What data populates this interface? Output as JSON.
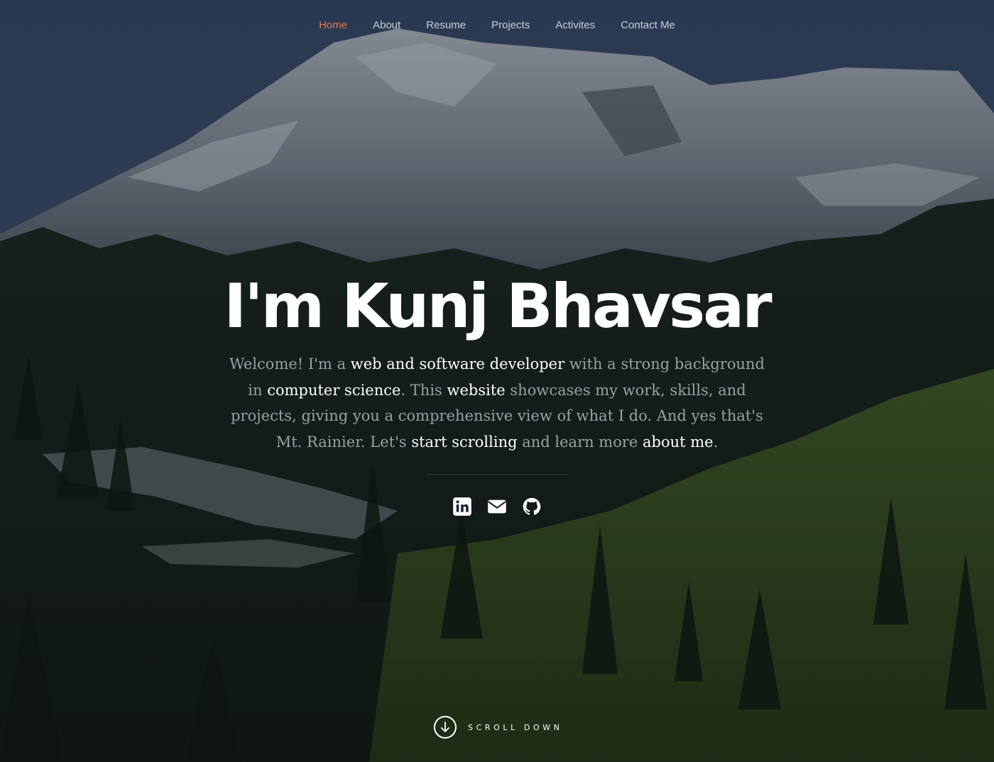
{
  "nav": {
    "items": [
      {
        "label": "Home",
        "active": true
      },
      {
        "label": "About",
        "active": false
      },
      {
        "label": "Resume",
        "active": false
      },
      {
        "label": "Projects",
        "active": false
      },
      {
        "label": "Activites",
        "active": false
      },
      {
        "label": "Contact Me",
        "active": false
      }
    ],
    "active_color": "#e5793f"
  },
  "hero": {
    "title": "I'm Kunj Bhavsar",
    "intro": [
      {
        "text": "Welcome! I'm a ",
        "highlight": false
      },
      {
        "text": "web and software developer",
        "highlight": true
      },
      {
        "text": " with a strong background in ",
        "highlight": false
      },
      {
        "text": "computer science",
        "highlight": true
      },
      {
        "text": ". This ",
        "highlight": false
      },
      {
        "text": "website",
        "highlight": true
      },
      {
        "text": " showcases my work, skills, and projects, giving you a comprehensive view of what I do. And yes that's Mt. Rainier. Let's ",
        "highlight": false
      },
      {
        "text": "start scrolling",
        "highlight": true
      },
      {
        "text": " and learn more ",
        "highlight": false
      },
      {
        "text": "about me",
        "highlight": true
      },
      {
        "text": ".",
        "highlight": false
      }
    ]
  },
  "socials": [
    {
      "icon": "linkedin-icon"
    },
    {
      "icon": "email-icon"
    },
    {
      "icon": "github-icon"
    }
  ],
  "scroll": {
    "label": "SCROLL DOWN",
    "icon": "arrow-down-circle-icon"
  }
}
